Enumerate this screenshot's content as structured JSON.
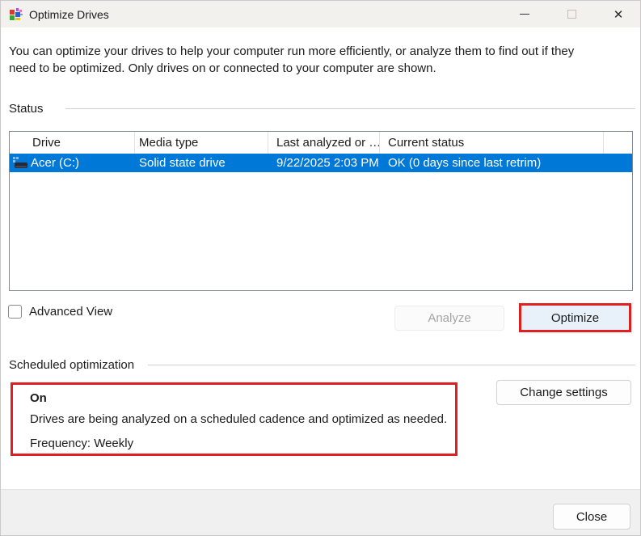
{
  "window": {
    "title": "Optimize Drives",
    "icons": {
      "minimize": "minimize",
      "maximize": "maximize",
      "close": "✕"
    }
  },
  "description": "You can optimize your drives to help your computer run more efficiently, or analyze them to find out if they need to be optimized. Only drives on or connected to your computer are shown.",
  "status_section": {
    "label": "Status",
    "table": {
      "columns": [
        "Drive",
        "Media type",
        "Last analyzed or …",
        "Current status"
      ],
      "rows": [
        {
          "drive": "Acer (C:)",
          "media_type": "Solid state drive",
          "last_analyzed": "9/22/2025 2:03 PM",
          "current_status": "OK (0 days since last retrim)",
          "selected": true
        }
      ]
    },
    "advanced_view_label": "Advanced View",
    "advanced_view_checked": false,
    "analyze_label": "Analyze",
    "analyze_enabled": false,
    "optimize_label": "Optimize"
  },
  "scheduled_section": {
    "label": "Scheduled optimization",
    "state": "On",
    "detail": "Drives are being analyzed on a scheduled cadence and optimized as needed.",
    "frequency": "Frequency: Weekly",
    "change_settings_label": "Change settings"
  },
  "footer": {
    "close_label": "Close"
  },
  "colors": {
    "selection_blue": "#0078d7",
    "annotation_red": "#e02020",
    "titlebar_bg": "#f3f1ee",
    "footer_bg": "#f0f0f0",
    "optimize_button_bg": "#e8f1f9"
  }
}
